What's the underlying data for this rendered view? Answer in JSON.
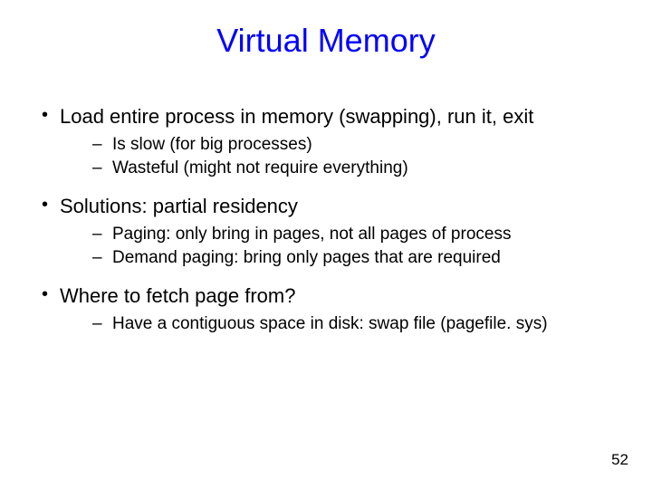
{
  "title": "Virtual Memory",
  "bullets": [
    {
      "text": "Load entire process in memory (swapping), run it, exit",
      "sub": [
        "Is slow (for big processes)",
        "Wasteful (might not require everything)"
      ]
    },
    {
      "text": "Solutions: partial residency",
      "sub": [
        "Paging: only bring in pages, not all pages of process",
        "Demand paging: bring only pages that are required"
      ]
    },
    {
      "text": "Where to fetch page from?",
      "sub": [
        "Have a contiguous space in disk: swap file (pagefile. sys)"
      ]
    }
  ],
  "page_number": "52"
}
